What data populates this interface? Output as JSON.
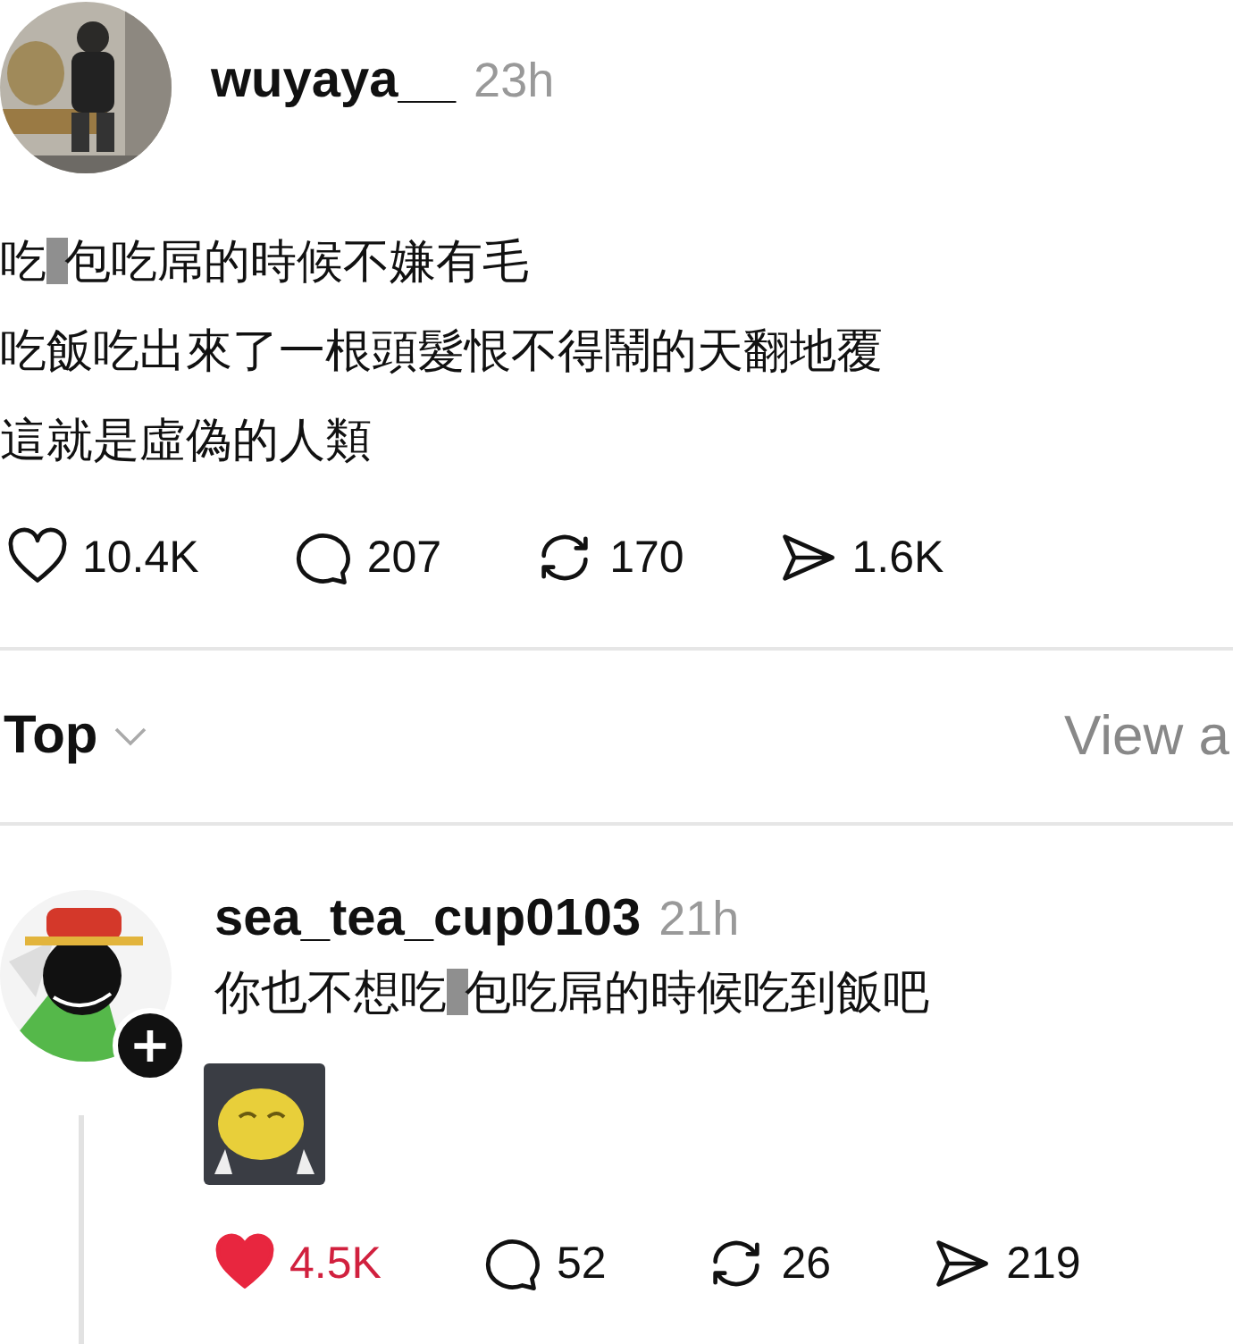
{
  "post": {
    "avatar": {
      "kind": "picture"
    },
    "username": "wuyaya__",
    "time": "23h",
    "lines": [
      [
        {
          "kind": "text",
          "text": "吃"
        },
        {
          "kind": "censor"
        },
        {
          "kind": "text",
          "text": "包吃屌的時候不嫌有毛"
        }
      ],
      [
        {
          "kind": "text",
          "text": "吃飯吃出來了一根頭髮恨不得鬧的天翻地覆"
        }
      ],
      [
        {
          "kind": "text",
          "text": "這就是虛偽的人類"
        }
      ]
    ],
    "liked": false,
    "actions": [
      {
        "kind": "like",
        "count": "10.4K"
      },
      {
        "kind": "comment",
        "count": "207"
      },
      {
        "kind": "repost",
        "count": "170"
      },
      {
        "kind": "share",
        "count": "1.6K"
      }
    ]
  },
  "sort": {
    "label": "Top",
    "link": "View a"
  },
  "reply": {
    "avatar": {
      "kind": "picture"
    },
    "follow_badge": "+",
    "username": "sea_tea_cup0103",
    "time": "21h",
    "lines": [
      [
        {
          "kind": "text",
          "text": "你也不想吃"
        },
        {
          "kind": "censor"
        },
        {
          "kind": "text",
          "text": "包吃屌的時候吃到飯吧"
        }
      ]
    ],
    "sticker": {
      "kind": "picture"
    },
    "liked": true,
    "actions": [
      {
        "kind": "like",
        "count": "4.5K"
      },
      {
        "kind": "comment",
        "count": "52"
      },
      {
        "kind": "repost",
        "count": "26"
      },
      {
        "kind": "share",
        "count": "219"
      }
    ]
  }
}
